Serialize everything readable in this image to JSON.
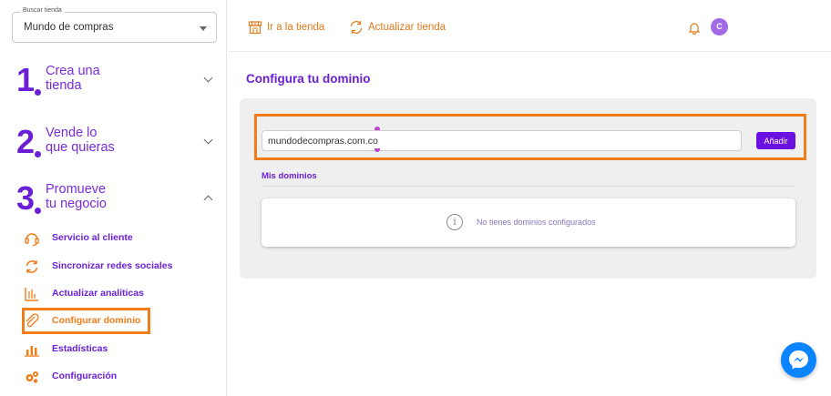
{
  "sidebar": {
    "store_select": {
      "legend": "Buscar tienda",
      "value": "Mundo de compras"
    },
    "steps": [
      {
        "number": "1",
        "label_line1": "Crea una",
        "label_line2": "tienda",
        "expanded": false
      },
      {
        "number": "2",
        "label_line1": "Vende lo",
        "label_line2": "que quieras",
        "expanded": false
      },
      {
        "number": "3",
        "label_line1": "Promueve",
        "label_line2": "tu negocio",
        "expanded": true
      }
    ],
    "menu": [
      {
        "label": "Servicio al cliente",
        "icon": "headset-icon"
      },
      {
        "label": "Sincronizar redes sociales",
        "icon": "sync-icon"
      },
      {
        "label": "Actualizar analíticas",
        "icon": "analytics-icon"
      },
      {
        "label": "Configurar dominio",
        "icon": "paperclip-icon",
        "active": true
      },
      {
        "label": "Estadísticas",
        "icon": "bar-chart-icon"
      },
      {
        "label": "Configuración",
        "icon": "gears-icon"
      }
    ]
  },
  "topbar": {
    "go_to_store": "Ir a la tienda",
    "update_store": "Actualizar tienda",
    "avatar_initial": "C"
  },
  "main": {
    "title": "Configura tu dominio",
    "domain_input_value": "mundodecompras.com.co",
    "add_button": "Añadir",
    "my_domains_label": "Mis dominios",
    "empty_message": "No tienes dominios configurados"
  },
  "colors": {
    "primary": "#6a1fd6",
    "accent_orange": "#f07d1a",
    "button": "#6a10e0",
    "messenger": "#0a84ff"
  }
}
